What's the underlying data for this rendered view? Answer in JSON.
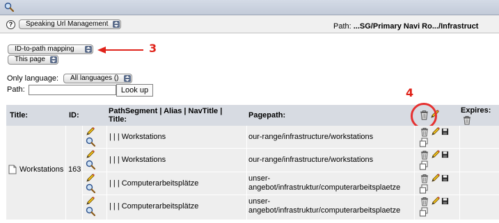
{
  "header": {
    "module_select": "Speaking Url Management",
    "path_label": "Path:",
    "path_value": "...SG/Primary Navi Ro.../Infrastruct"
  },
  "controls": {
    "mode_select": "ID-to-path mapping",
    "scope_select": "This page",
    "language_label": "Only language:",
    "language_select": "All languages ()",
    "path_label": "Path:",
    "path_input": "",
    "lookup_button": "Look up"
  },
  "annotations": {
    "marker_3": "3",
    "marker_4": "4"
  },
  "table": {
    "headers": {
      "title": "Title:",
      "id": "ID:",
      "segment": "PathSegment | Alias | NavTitle | Title:",
      "pagepath": "Pagepath:",
      "expires": "Expires:"
    },
    "page_title": "Workstations",
    "page_id": "163",
    "rows": [
      {
        "segment": "| | | Workstations",
        "pagepath_1": "our-range/infrastructure/workstations",
        "pagepath_2": ""
      },
      {
        "segment": "| | | Workstations",
        "pagepath_1": "our-range/infrastructure/workstations",
        "pagepath_2": ""
      },
      {
        "segment": "| | | Computerarbeitsplätze",
        "pagepath_1": "unser-",
        "pagepath_2": "angebot/infrastruktur/computerarbeitsplaetze"
      },
      {
        "segment": "| | | Computerarbeitsplätze",
        "pagepath_1": "unser-",
        "pagepath_2": "angebot/infrastruktur/computerarbeitsplaetze"
      }
    ]
  },
  "colors": {
    "annotation_red": "#e0231a",
    "header_bg": "#d7dbe2",
    "cell_bg": "#eeeeee"
  }
}
